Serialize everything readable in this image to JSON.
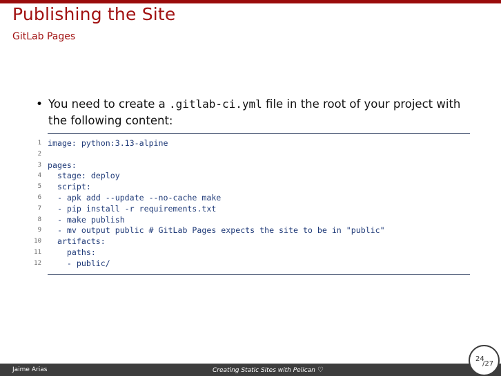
{
  "slide": {
    "title": "Publishing the Site",
    "subtitle": "GitLab Pages"
  },
  "bullet": {
    "text_before": "You need to create a ",
    "code": ".gitlab-ci.yml",
    "text_after": " file in the root of your project with the following content:"
  },
  "code": {
    "line_numbers": [
      "1",
      "2",
      "3",
      "4",
      "5",
      "6",
      "7",
      "8",
      "9",
      "10",
      "11",
      "12"
    ],
    "lines": [
      "image: python:3.13-alpine",
      "",
      "pages:",
      "  stage: deploy",
      "  script:",
      "  - apk add --update --no-cache make",
      "  - pip install -r requirements.txt",
      "  - make publish",
      "  - mv output public # GitLab Pages expects the site to be in \"public\"",
      "  artifacts:",
      "    paths:",
      "    - public/"
    ]
  },
  "footer": {
    "author": "Jaime Arias",
    "title": "Creating Static Sites with Pelican",
    "heart_icon": "heart-outline-icon",
    "page_current": "24",
    "page_total": "27"
  },
  "colors": {
    "accent": "#a11111",
    "top_bar": "#9a0b0b",
    "footer_bg": "#3d3d3d",
    "code_text": "#1f3a78"
  }
}
